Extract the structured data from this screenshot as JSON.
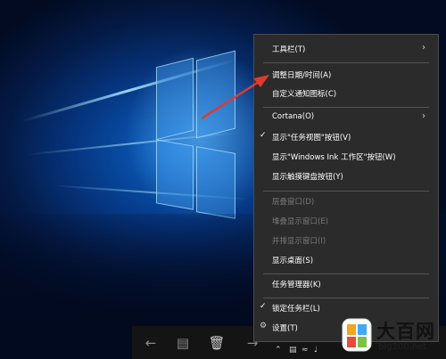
{
  "context_menu": {
    "items": [
      {
        "label": "工具栏(T)",
        "submenu": true,
        "enabled": true
      },
      {
        "label": "调整日期/时间(A)",
        "enabled": true
      },
      {
        "label": "自定义通知图标(C)",
        "enabled": true
      },
      {
        "label": "Cortana(O)",
        "submenu": true,
        "enabled": true
      },
      {
        "label": "显示\"任务视图\"按钮(V)",
        "checked": true,
        "enabled": true
      },
      {
        "label": "显示\"Windows Ink 工作区\"按钮(W)",
        "enabled": true
      },
      {
        "label": "显示触摸键盘按钮(Y)",
        "enabled": true
      },
      {
        "label": "层叠窗口(D)",
        "enabled": false
      },
      {
        "label": "堆叠显示窗口(E)",
        "enabled": false
      },
      {
        "label": "并排显示窗口(I)",
        "enabled": false
      },
      {
        "label": "显示桌面(S)",
        "enabled": true
      },
      {
        "label": "任务管理器(K)",
        "enabled": true
      },
      {
        "label": "锁定任务栏(L)",
        "checked": true,
        "enabled": true
      },
      {
        "label": "设置(T)",
        "enabled": true
      }
    ]
  },
  "watermark": {
    "title": "大百网",
    "subtitle": "big100.net"
  },
  "colors": {
    "menu_bg": "#2b2b2b",
    "arrow": "#e03a2e",
    "taskbar": "#141414"
  },
  "icons": {
    "submenu": "chevron-right-icon",
    "check": "checkmark-icon"
  }
}
